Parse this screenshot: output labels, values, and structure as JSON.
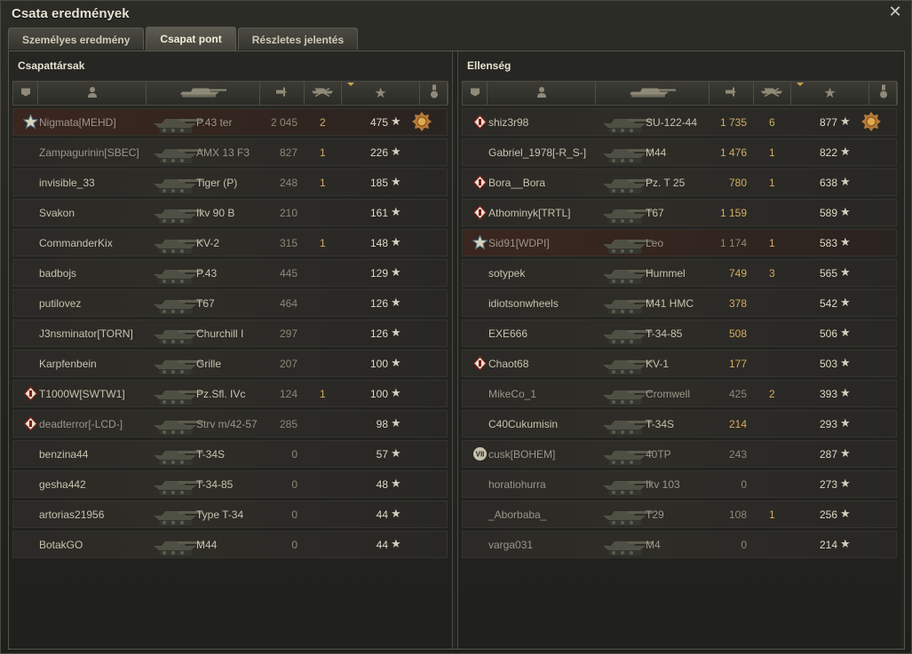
{
  "window": {
    "title": "Csata eredmények",
    "close_icon": "close-icon"
  },
  "tabs": [
    {
      "label": "Személyes eredmény",
      "active": false
    },
    {
      "label": "Csapat pont",
      "active": true
    },
    {
      "label": "Részletes jelentés",
      "active": false
    }
  ],
  "star_glyph": "★",
  "teams": {
    "allies": {
      "title": "Csapattársak",
      "players": [
        {
          "name": "Nigmata[MEHD]",
          "vehicle": "P.43 ter",
          "damage": "2 045",
          "kills": "2",
          "xp": "475",
          "badge": "ace-icon",
          "medal": true,
          "dmg_gold": false,
          "highlight": true,
          "dim": true
        },
        {
          "name": "Zampagurinin[SBEC]",
          "vehicle": "AMX 13 F3",
          "damage": "827",
          "kills": "1",
          "xp": "226",
          "badge": "",
          "medal": false,
          "dmg_gold": false,
          "highlight": false,
          "dim": true
        },
        {
          "name": "invisible_33",
          "vehicle": "Tiger (P)",
          "damage": "248",
          "kills": "1",
          "xp": "185",
          "badge": "",
          "medal": false,
          "dmg_gold": false,
          "highlight": false,
          "dim": false
        },
        {
          "name": "Svakon",
          "vehicle": "Ikv 90 B",
          "damage": "210",
          "kills": "",
          "xp": "161",
          "badge": "",
          "medal": false,
          "dmg_gold": false,
          "highlight": false,
          "dim": false
        },
        {
          "name": "CommanderKix",
          "vehicle": "KV-2",
          "damage": "315",
          "kills": "1",
          "xp": "148",
          "badge": "",
          "medal": false,
          "dmg_gold": false,
          "highlight": false,
          "dim": false
        },
        {
          "name": "badbojs",
          "vehicle": "P.43",
          "damage": "445",
          "kills": "",
          "xp": "129",
          "badge": "",
          "medal": false,
          "dmg_gold": false,
          "highlight": false,
          "dim": false
        },
        {
          "name": "putilovez",
          "vehicle": "T67",
          "damage": "464",
          "kills": "",
          "xp": "126",
          "badge": "",
          "medal": false,
          "dmg_gold": false,
          "highlight": false,
          "dim": false
        },
        {
          "name": "J3nsminator[TORN]",
          "vehicle": "Churchill I",
          "damage": "297",
          "kills": "",
          "xp": "126",
          "badge": "",
          "medal": false,
          "dmg_gold": false,
          "highlight": false,
          "dim": false
        },
        {
          "name": "Karpfenbein",
          "vehicle": "Grille",
          "damage": "207",
          "kills": "",
          "xp": "100",
          "badge": "",
          "medal": false,
          "dmg_gold": false,
          "highlight": false,
          "dim": false
        },
        {
          "name": "T1000W[SWTW1]",
          "vehicle": "Pz.Sfl. IVc",
          "damage": "124",
          "kills": "1",
          "xp": "100",
          "badge": "clan-icon",
          "medal": false,
          "dmg_gold": false,
          "highlight": false,
          "dim": false
        },
        {
          "name": "deadterror[-LCD-]",
          "vehicle": "Strv m/42-57",
          "damage": "285",
          "kills": "",
          "xp": "98",
          "badge": "clan-icon",
          "medal": false,
          "dmg_gold": false,
          "highlight": false,
          "dim": true
        },
        {
          "name": "benzina44",
          "vehicle": "T-34S",
          "damage": "0",
          "kills": "",
          "xp": "57",
          "badge": "",
          "medal": false,
          "dmg_gold": false,
          "highlight": false,
          "dim": false
        },
        {
          "name": "gesha442",
          "vehicle": "T-34-85",
          "damage": "0",
          "kills": "",
          "xp": "48",
          "badge": "",
          "medal": false,
          "dmg_gold": false,
          "highlight": false,
          "dim": false
        },
        {
          "name": "artorias21956",
          "vehicle": "Type T-34",
          "damage": "0",
          "kills": "",
          "xp": "44",
          "badge": "",
          "medal": false,
          "dmg_gold": false,
          "highlight": false,
          "dim": false
        },
        {
          "name": "BotakGO",
          "vehicle": "M44",
          "damage": "0",
          "kills": "",
          "xp": "44",
          "badge": "",
          "medal": false,
          "dmg_gold": false,
          "highlight": false,
          "dim": false
        }
      ]
    },
    "enemies": {
      "title": "Ellenség",
      "players": [
        {
          "name": "shiz3r98",
          "vehicle": "SU-122-44",
          "damage": "1 735",
          "kills": "6",
          "xp": "877",
          "badge": "clan-icon",
          "medal": true,
          "dmg_gold": true,
          "highlight": false,
          "dim": false
        },
        {
          "name": "Gabriel_1978[-R_S-]",
          "vehicle": "M44",
          "damage": "1 476",
          "kills": "1",
          "xp": "822",
          "badge": "",
          "medal": false,
          "dmg_gold": true,
          "highlight": false,
          "dim": false
        },
        {
          "name": "Bora__Bora",
          "vehicle": "Pz. T 25",
          "damage": "780",
          "kills": "1",
          "xp": "638",
          "badge": "clan-icon",
          "medal": false,
          "dmg_gold": true,
          "highlight": false,
          "dim": false
        },
        {
          "name": "Athominyk[TRTL]",
          "vehicle": "T67",
          "damage": "1 159",
          "kills": "",
          "xp": "589",
          "badge": "clan-icon",
          "medal": false,
          "dmg_gold": true,
          "highlight": false,
          "dim": false
        },
        {
          "name": "Sid91[WDPI]",
          "vehicle": "Leo",
          "damage": "1 174",
          "kills": "1",
          "xp": "583",
          "badge": "ace-icon",
          "medal": false,
          "dmg_gold": false,
          "highlight": true,
          "dim": true
        },
        {
          "name": "sotypek",
          "vehicle": "Hummel",
          "damage": "749",
          "kills": "3",
          "xp": "565",
          "badge": "",
          "medal": false,
          "dmg_gold": true,
          "highlight": false,
          "dim": false
        },
        {
          "name": "idiotsonwheels",
          "vehicle": "M41 HMC",
          "damage": "378",
          "kills": "",
          "xp": "542",
          "badge": "",
          "medal": false,
          "dmg_gold": true,
          "highlight": false,
          "dim": false
        },
        {
          "name": "EXE666",
          "vehicle": "T-34-85",
          "damage": "508",
          "kills": "",
          "xp": "506",
          "badge": "",
          "medal": false,
          "dmg_gold": true,
          "highlight": false,
          "dim": false
        },
        {
          "name": "Chaot68",
          "vehicle": "KV-1",
          "damage": "177",
          "kills": "",
          "xp": "503",
          "badge": "clan-icon",
          "medal": false,
          "dmg_gold": true,
          "highlight": false,
          "dim": false
        },
        {
          "name": "MikeCo_1",
          "vehicle": "Cromwell",
          "damage": "425",
          "kills": "2",
          "xp": "393",
          "badge": "",
          "medal": false,
          "dmg_gold": false,
          "highlight": false,
          "dim": true
        },
        {
          "name": "C40Cukumisin",
          "vehicle": "T-34S",
          "damage": "214",
          "kills": "",
          "xp": "293",
          "badge": "",
          "medal": false,
          "dmg_gold": true,
          "highlight": false,
          "dim": false
        },
        {
          "name": "cusk[BOHEM]",
          "vehicle": "40TP",
          "damage": "243",
          "kills": "",
          "xp": "287",
          "badge": "class-badge-icon",
          "medal": false,
          "dmg_gold": false,
          "highlight": false,
          "dim": true
        },
        {
          "name": "horatiohurra",
          "vehicle": "Ikv 103",
          "damage": "0",
          "kills": "",
          "xp": "273",
          "badge": "",
          "medal": false,
          "dmg_gold": false,
          "highlight": false,
          "dim": true
        },
        {
          "name": "_Aborbaba_",
          "vehicle": "T29",
          "damage": "108",
          "kills": "1",
          "xp": "256",
          "badge": "",
          "medal": false,
          "dmg_gold": false,
          "highlight": false,
          "dim": true
        },
        {
          "name": "varga031",
          "vehicle": "M4",
          "damage": "0",
          "kills": "",
          "xp": "214",
          "badge": "",
          "medal": false,
          "dmg_gold": false,
          "highlight": false,
          "dim": true
        }
      ]
    }
  },
  "columns": [
    {
      "icon": "squad-icon"
    },
    {
      "icon": "player-icon"
    },
    {
      "icon": "tank-icon"
    },
    {
      "icon": "damage-icon"
    },
    {
      "icon": "kills-icon"
    },
    {
      "icon": "xp-star-icon",
      "sorted": true
    },
    {
      "icon": "medal-icon"
    }
  ]
}
